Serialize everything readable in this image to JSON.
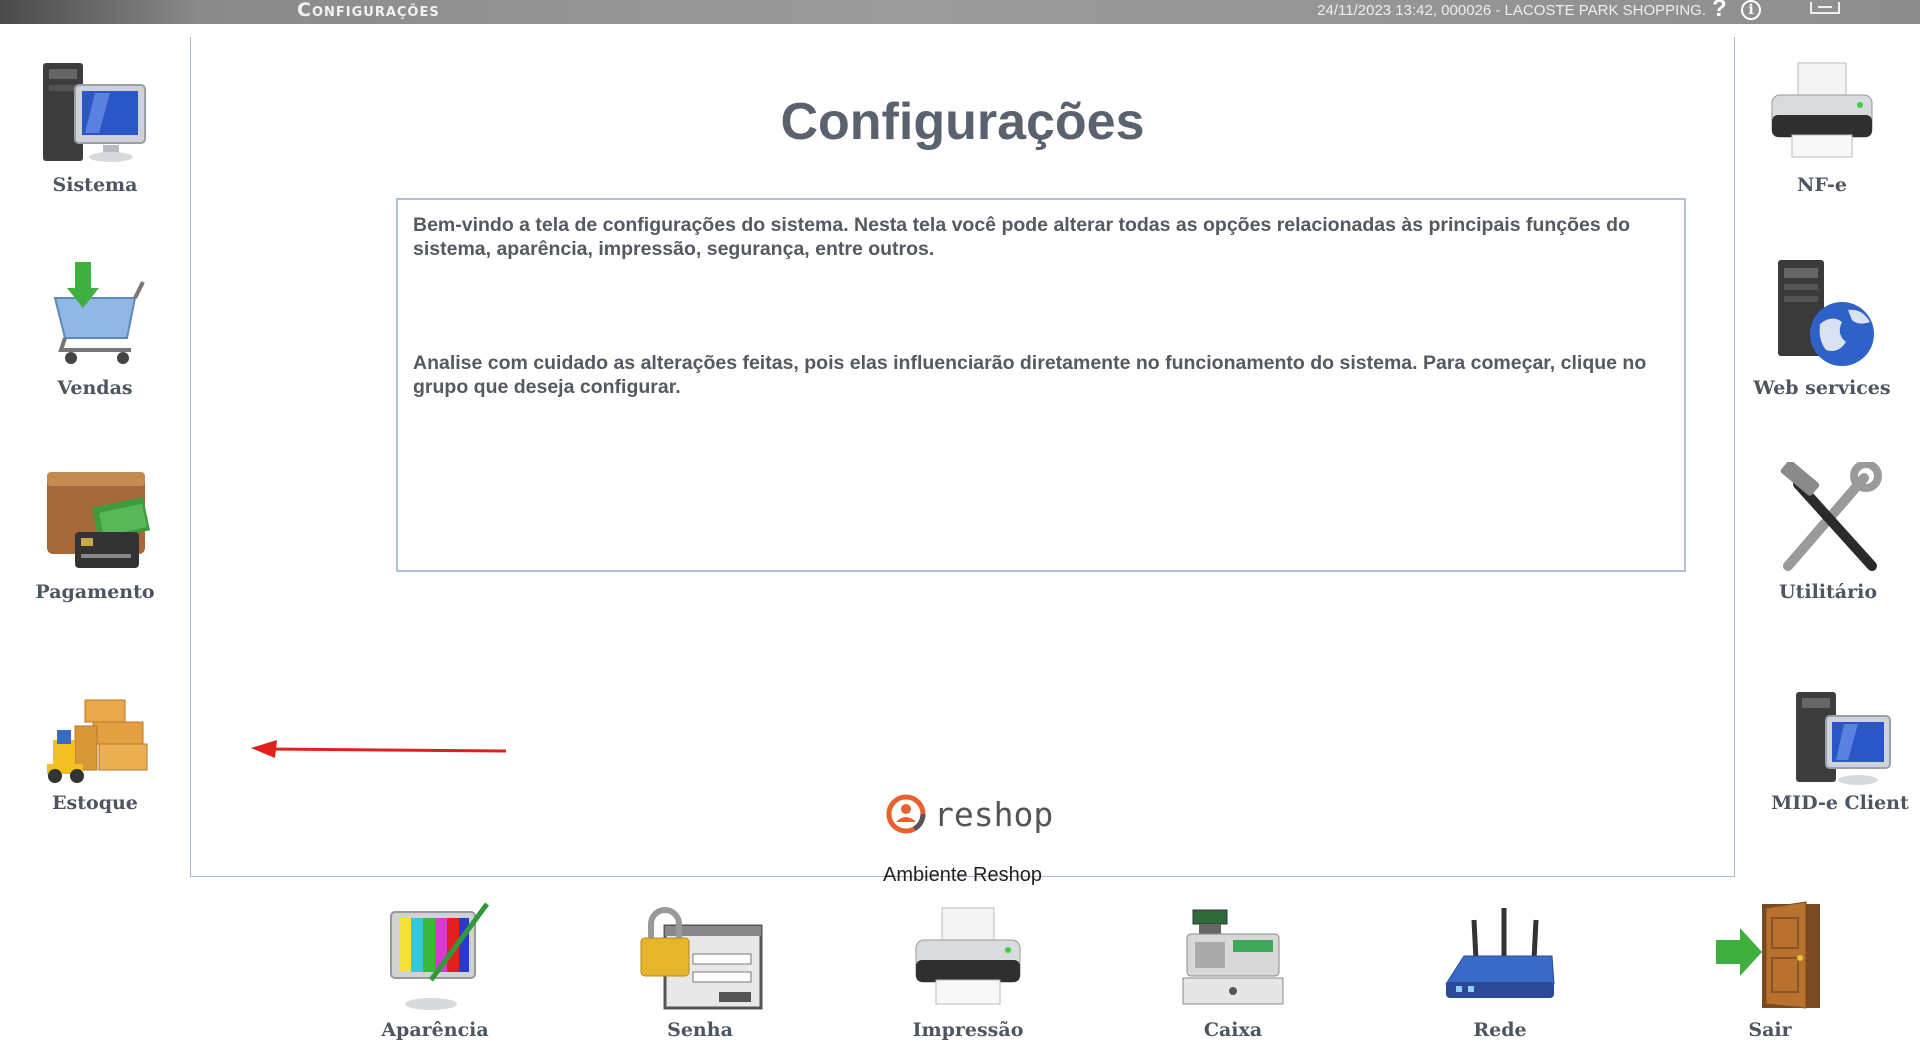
{
  "titlebar": {
    "app_title": "Configurações",
    "status": "24/11/2023 13:42, 000026 - LACOSTE PARK SHOPPING.",
    "help_icon": "?",
    "info_icon": "i"
  },
  "main": {
    "title": "Configurações",
    "paragraph1": "Bem-vindo a tela de configurações do sistema. Nesta tela você pode alterar todas as opções relacionadas às principais funções do sistema, aparência, impressão, segurança, entre outros.",
    "paragraph2": "Analise com cuidado as alterações feitas, pois elas influenciarão diretamente no funcionamento do sistema. Para começar, clique no grupo que deseja configurar.",
    "brand_name": "reshop",
    "environment_label": "Ambiente Reshop"
  },
  "left_nav": [
    {
      "label": "Sistema",
      "icon": "computer-icon"
    },
    {
      "label": "Vendas",
      "icon": "shopping-cart-icon"
    },
    {
      "label": "Pagamento",
      "icon": "wallet-icon"
    },
    {
      "label": "Estoque",
      "icon": "forklift-boxes-icon"
    }
  ],
  "right_nav": [
    {
      "label": "NF-e",
      "icon": "printer-icon"
    },
    {
      "label": "Web services",
      "icon": "server-globe-icon"
    },
    {
      "label": "Utilitário",
      "icon": "tools-icon"
    },
    {
      "label": "MID-e Client",
      "icon": "computer-icon"
    }
  ],
  "bottom_nav": [
    {
      "label": "Aparência",
      "icon": "monitor-paint-icon"
    },
    {
      "label": "Senha",
      "icon": "lock-login-icon"
    },
    {
      "label": "Impressão",
      "icon": "printer-icon"
    },
    {
      "label": "Caixa",
      "icon": "cash-register-icon"
    },
    {
      "label": "Rede",
      "icon": "router-icon"
    },
    {
      "label": "Sair",
      "icon": "exit-door-icon"
    }
  ],
  "colors": {
    "arrow": "#e0201c",
    "title_text": "#5a6270",
    "brand_orange": "#e8612c"
  }
}
